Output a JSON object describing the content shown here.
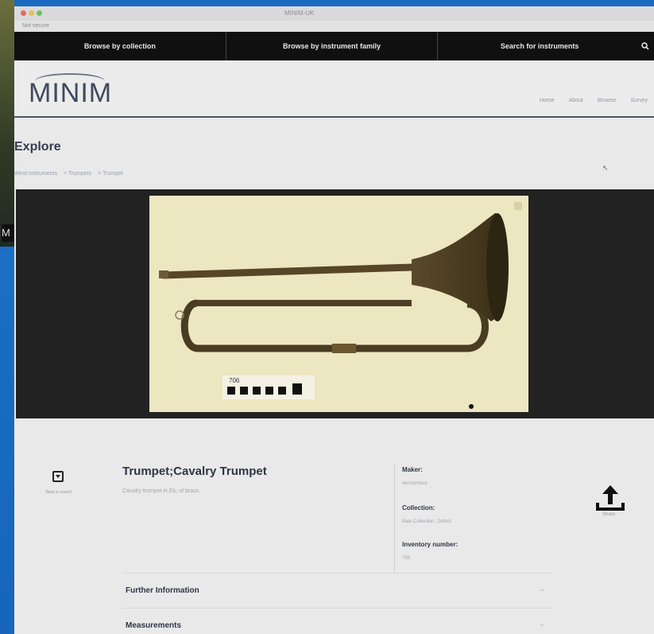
{
  "desktop": {
    "edge_label": "M"
  },
  "window": {
    "title": "MINIM-UK",
    "url": "Not secure"
  },
  "nav": {
    "items": [
      {
        "label": "Browse by collection"
      },
      {
        "label": "Browse by instrument family"
      },
      {
        "label": "Search for instruments"
      }
    ]
  },
  "site": {
    "logo": "MINIM",
    "menu": [
      "Home",
      "About",
      "Browse",
      "Survey"
    ]
  },
  "page": {
    "heading": "Explore",
    "breadcrumbs": [
      "Wind instruments",
      "> Trumpets",
      "> Trumpet"
    ]
  },
  "photo": {
    "tag_number": "706"
  },
  "instrument": {
    "title": "Trumpet;Cavalry Trumpet",
    "description": "Cavalry trumpet in Eb; of brass.",
    "download_label": "Back to search",
    "share_label": "Share",
    "meta": [
      {
        "key": "Maker:",
        "value": "Anonymous"
      },
      {
        "key": "Collection:",
        "value": "Bate Collection, Oxford"
      },
      {
        "key": "Inventory number:",
        "value": "706"
      }
    ]
  },
  "sections": [
    {
      "label": "Further Information"
    },
    {
      "label": "Measurements"
    }
  ],
  "colors": {
    "nav_bg": "#101010",
    "logo": "#3f4a5e",
    "desktop": "#1f63b4"
  }
}
